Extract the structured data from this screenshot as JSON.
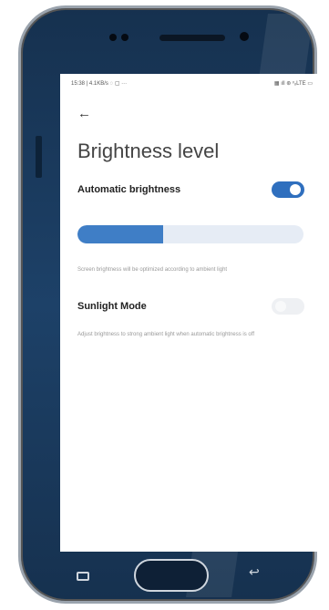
{
  "status_bar": {
    "left": "15:38 | 4.1KB/s ◌ ▢ ···",
    "right": "▦ ıll ⊛ ᵛₒLTE ▭"
  },
  "header": {
    "back_icon": "arrow-left-icon",
    "title": "Brightness level"
  },
  "automatic_brightness": {
    "label": "Automatic brightness",
    "enabled": true,
    "description": "Screen brightness will be optimized according to ambient light"
  },
  "brightness_slider": {
    "level": 0.38
  },
  "sunlight_mode": {
    "label": "Sunlight Mode",
    "enabled": false,
    "description": "Adjust brightness to strong ambient light when automatic brightness is off"
  },
  "device_keys": {
    "recent": "recent-apps-icon",
    "home": "home-button",
    "back": "back-icon"
  },
  "colors": {
    "accent": "#2f6fbe",
    "slider_fill": "#3f7ec6",
    "slider_track": "#e6ecf5",
    "phone_body": "#1d4168"
  }
}
